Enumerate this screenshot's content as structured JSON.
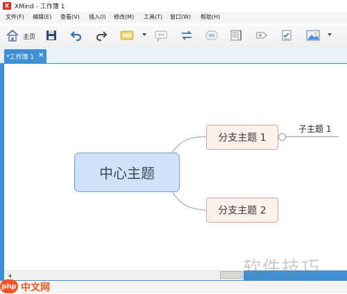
{
  "window": {
    "title": "XMind - 工作簿 1",
    "app_logo": "X"
  },
  "menu": [
    {
      "label": "文件(F)"
    },
    {
      "label": "编辑(E)"
    },
    {
      "label": "查看(V)"
    },
    {
      "label": "插入(I)"
    },
    {
      "label": "修改(M)"
    },
    {
      "label": "工具(T)"
    },
    {
      "label": "窗口(W)"
    },
    {
      "label": "帮助(H)"
    }
  ],
  "toolbar": {
    "home_label": "主页",
    "icons": [
      "home-icon",
      "save-icon",
      "undo-icon",
      "redo-icon",
      "topic-style-icon",
      "callout-icon",
      "relationship-icon",
      "boundary-icon",
      "summary-icon",
      "marker-icon",
      "task-icon",
      "image-icon"
    ]
  },
  "tab": {
    "label": "*工作簿 1",
    "close": "×"
  },
  "mindmap": {
    "central": "中心主题",
    "branch1": "分支主题 1",
    "branch2": "分支主题 2",
    "subtopic": "子主题 1"
  },
  "watermark": {
    "text": "软件技巧",
    "logo": "php",
    "site": "中文网"
  },
  "colors": {
    "accent": "#3f8fd2",
    "central_fill": "#cfe2f8",
    "branch_fill": "#fcf0eb",
    "branch_border": "#dba592"
  }
}
